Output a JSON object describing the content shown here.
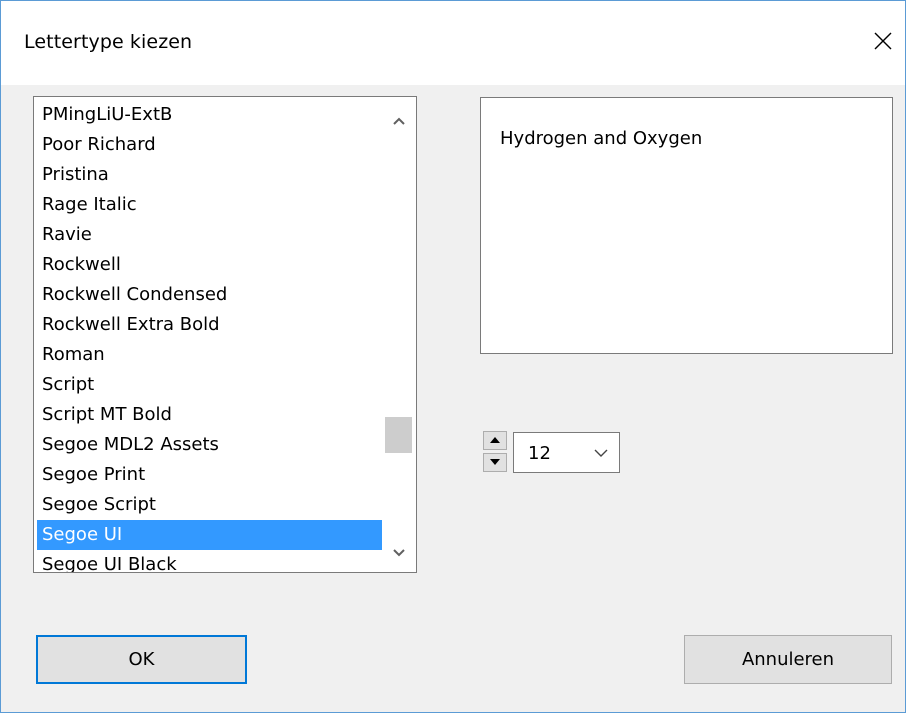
{
  "dialog": {
    "title": "Lettertype kiezen"
  },
  "font_list": {
    "items": [
      "PMingLiU-ExtB",
      "Poor Richard",
      "Pristina",
      "Rage Italic",
      "Ravie",
      "Rockwell",
      "Rockwell Condensed",
      "Rockwell Extra Bold",
      "Roman",
      "Script",
      "Script MT Bold",
      "Segoe MDL2 Assets",
      "Segoe Print",
      "Segoe Script",
      "Segoe UI",
      "Segoe UI Black"
    ],
    "selected": "Segoe UI"
  },
  "preview": {
    "text": "Hydrogen and Oxygen"
  },
  "size": {
    "value": "12"
  },
  "buttons": {
    "ok": "OK",
    "cancel": "Annuleren"
  },
  "colors": {
    "accent": "#0078d7",
    "selection": "#3399ff",
    "window_border": "#5b9bd5"
  }
}
